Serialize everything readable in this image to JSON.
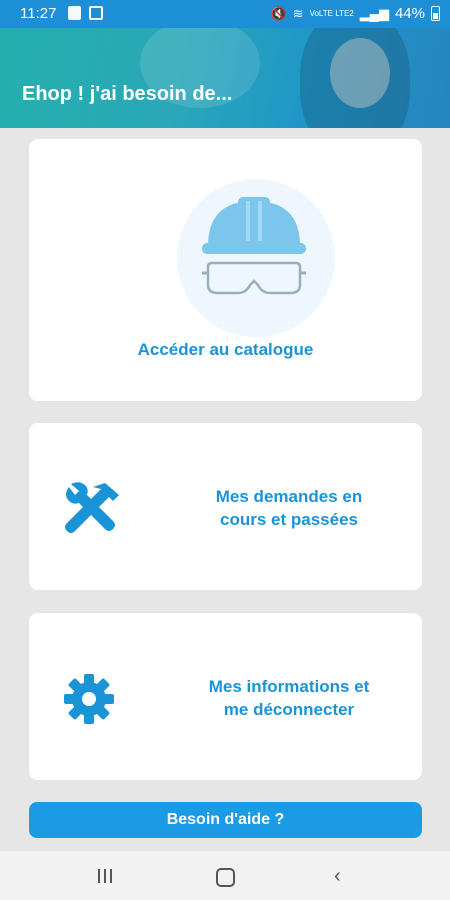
{
  "status_bar": {
    "time": "11:27",
    "network_label": "VoLTE LTE2",
    "battery": "44%"
  },
  "header": {
    "title": "Ehop ! j'ai besoin de..."
  },
  "cards": {
    "catalog": {
      "label": "Accéder au catalogue",
      "icon": "hardhat-goggles-icon"
    },
    "orders": {
      "line1": "Mes demandes en",
      "line2": "cours et passées",
      "icon": "tools-icon"
    },
    "account": {
      "line1": "Mes informations et",
      "line2": "me déconnecter",
      "icon": "gear-icon"
    }
  },
  "help_button": {
    "label": "Besoin d'aide ?"
  },
  "colors": {
    "accent": "#1a94d6",
    "status_bar": "#1c8fd6",
    "background": "#e6e6e6",
    "icon_light": "#7cc6ee"
  }
}
